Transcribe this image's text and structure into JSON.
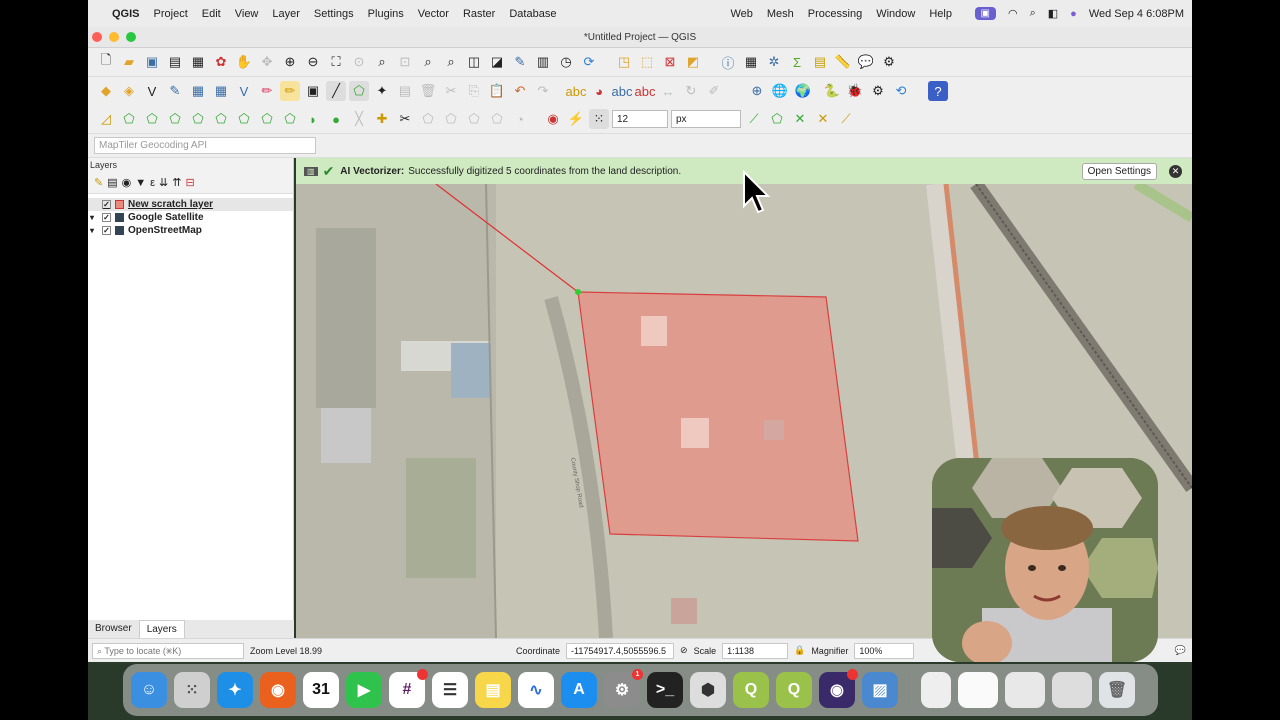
{
  "menubar": {
    "app": "QGIS",
    "items": [
      "Project",
      "Edit",
      "View",
      "Layer",
      "Settings",
      "Plugins",
      "Vector",
      "Raster",
      "Database",
      "Web",
      "Mesh",
      "Processing",
      "Window",
      "Help"
    ],
    "clock": "Wed Sep 4  6:08PM"
  },
  "window": {
    "title": "*Untitled Project — QGIS"
  },
  "toolbar": {
    "font_size": "12",
    "unit": "px"
  },
  "geocoder": {
    "placeholder": "MapTiler Geocoding API"
  },
  "layers_panel": {
    "title": "Layers",
    "layers": [
      {
        "name": "New scratch layer",
        "checked": "✓"
      },
      {
        "name": "Google Satellite",
        "checked": "✓"
      },
      {
        "name": "OpenStreetMap",
        "checked": "✓"
      }
    ],
    "tabs": [
      "Browser",
      "Layers"
    ]
  },
  "message_bar": {
    "title": "AI Vectorizer:",
    "text": "Successfully digitized 5 coordinates from the land description.",
    "button": "Open Settings"
  },
  "statusbar": {
    "locate_placeholder": "Type to locate (⌘K)",
    "zoom": "Zoom Level 18.99",
    "coordinate_label": "Coordinate",
    "coordinate": "-11754917.4,5055596.5",
    "scale_label": "Scale",
    "scale": "1:1138",
    "magnifier_label": "Magnifier",
    "magnifier": "100%"
  },
  "map_labels": {
    "road": "County Shop Road"
  },
  "dock": {
    "calendar_day": "31",
    "badge": "1",
    "apps": [
      "finder-icon",
      "launchpad-icon",
      "safari-icon",
      "firefox-icon",
      "calendar-icon",
      "facetime-icon",
      "slack-icon",
      "reminders-icon",
      "notes-icon",
      "freeform-icon",
      "appstore-icon",
      "settings-icon",
      "terminal-icon",
      "box-icon",
      "qgis-icon",
      "qgis-icon-2",
      "obs-icon",
      "preview-icon"
    ]
  },
  "colors": {
    "polygon_fill": "#e98a7f",
    "polygon_stroke": "#d84040",
    "message_bar": "#cfe9c1"
  }
}
